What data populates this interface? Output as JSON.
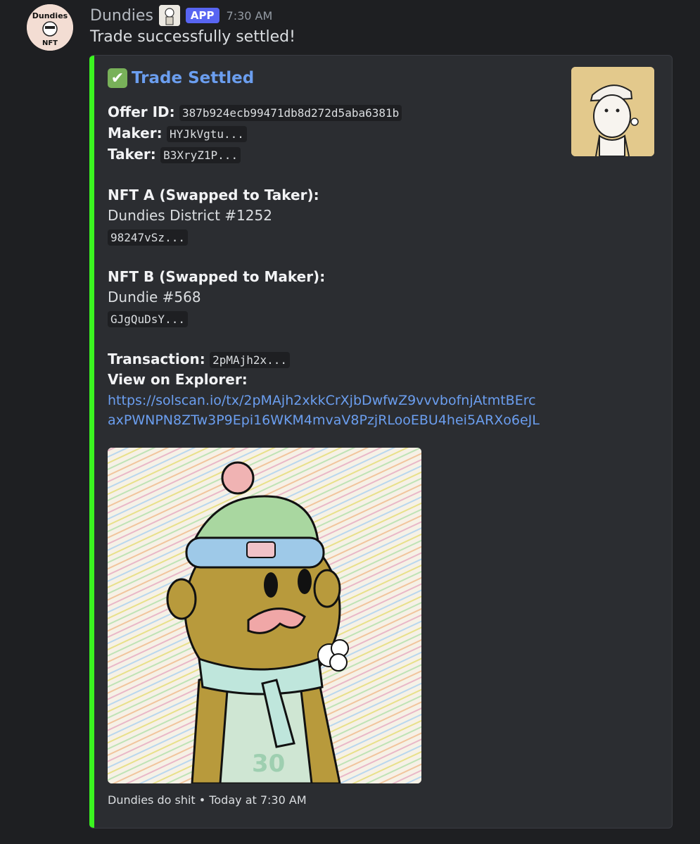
{
  "message": {
    "username": "Dundies",
    "app_badge": "APP",
    "timestamp": "7:30 AM",
    "content": "Trade successfully settled!"
  },
  "embed": {
    "accent_color": "#3bf520",
    "title_emoji": "✔",
    "title": "Trade Settled",
    "offer_label": "Offer ID:",
    "offer_id": "387b924ecb99471db8d272d5aba6381b",
    "maker_label": "Maker:",
    "maker": "HYJkVgtu...",
    "taker_label": "Taker:",
    "taker": "B3XryZ1P...",
    "nft_a_label": "NFT A (Swapped to Taker):",
    "nft_a_name": "Dundies District #1252",
    "nft_a_mint": "98247vSz...",
    "nft_b_label": "NFT B (Swapped to Maker):",
    "nft_b_name": "Dundie #568",
    "nft_b_mint": "GJgQuDsY...",
    "tx_label": "Transaction:",
    "tx": "2pMAjh2x...",
    "explorer_label": "View on Explorer:",
    "explorer_url_line1": "https://solscan.io/tx/2pMAjh2xkkCrXjbDwfwZ9vvvbofnjAtmtBErc",
    "explorer_url_line2": "axPWNPN8ZTw3P9Epi16WKM4mvaV8PzjRLooEBU4hei5ARXo6eJL",
    "footer_text": "Dundies do shit",
    "footer_sep": "•",
    "footer_time": "Today at 7:30 AM"
  },
  "images": {
    "avatar": "dundies-nft-avatar",
    "thumbnail": "nft-character-thumbnail",
    "main": "nft-character-beanie-scarf"
  }
}
